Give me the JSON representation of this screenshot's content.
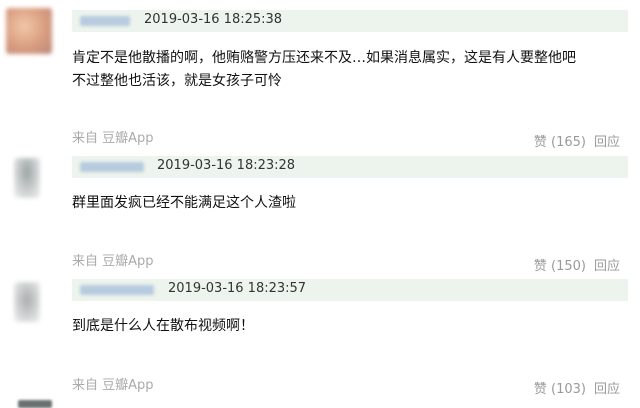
{
  "comments": [
    {
      "timestamp": "2019-03-16 18:25:38",
      "lines": [
        "肯定不是他散播的啊，他贿赂警方压还来不及…如果消息属实，这是有人要整他吧",
        "不过整他也活该，就是女孩子可怜"
      ],
      "source": "来自 豆瓣App",
      "like": "赞 (165)",
      "reply": "回应"
    },
    {
      "timestamp": "2019-03-16 18:23:28",
      "lines": [
        "群里面发疯已经不能满足这个人渣啦"
      ],
      "source": "来自 豆瓣App",
      "like": "赞 (150)",
      "reply": "回应"
    },
    {
      "timestamp": "2019-03-16 18:23:57",
      "lines": [
        "到底是什么人在散布视频啊！"
      ],
      "source": "来自 豆瓣App",
      "like": "赞 (103)",
      "reply": "回应"
    }
  ],
  "colors": {
    "header_bg": "#edf4ed",
    "meta_text": "#9a9a9a",
    "blurred_name": "#b7cbdf"
  },
  "icons": [
    "blurred-avatar"
  ]
}
